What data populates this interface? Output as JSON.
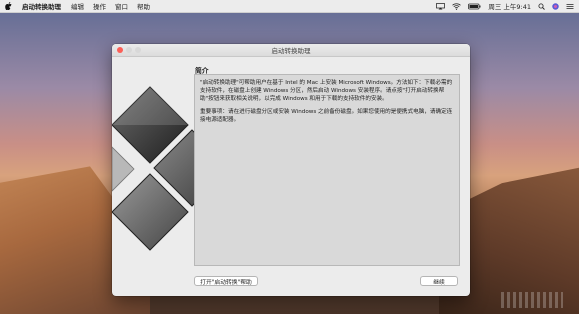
{
  "menubar": {
    "app_name": "启动转换助理",
    "items": [
      "编辑",
      "操作",
      "窗口",
      "帮助"
    ],
    "clock": "周三 上午9:41"
  },
  "window": {
    "title": "启动转换助理",
    "section_title": "简介",
    "paragraphs": [
      "\"启动转换助理\"可帮助用户在基于 Intel 的 Mac 上安装 Microsoft Windows。方法如下：下载必需的支持软件，在磁盘上创建 Windows 分区，然后启动 Windows 安装程序。请点按\"打开启动转换帮助\"按钮来获取相关说明，以完成 Windows 和用于下载的支持软件的安装。",
      "重要事项：请在进行磁盘分区或安装 Windows 之前备份磁盘。如果您使用的是便携式电脑，请确定连接电源适配器。"
    ],
    "help_button": "打开\"启动转换\"帮助",
    "continue_button": "继续"
  },
  "icons": [
    "apple-icon",
    "airplay-icon",
    "wifi-icon",
    "battery-icon",
    "search-icon",
    "siri-icon",
    "control-center-icon",
    "windows-logo-icon"
  ]
}
